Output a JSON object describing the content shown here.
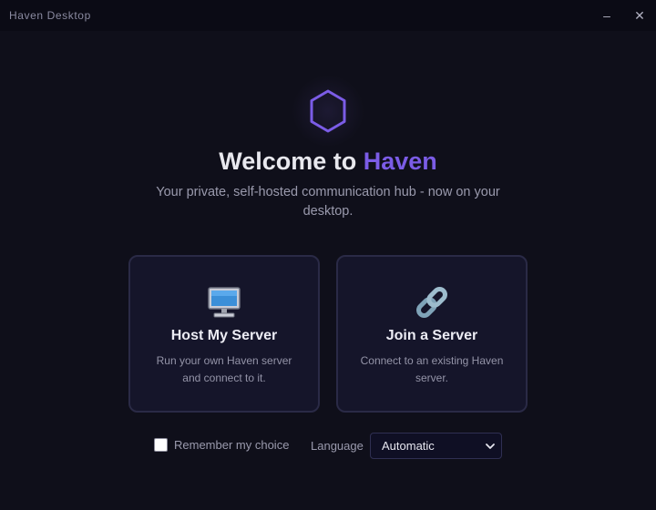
{
  "window": {
    "title": "Haven Desktop",
    "minimize_label": "–",
    "close_label": "✕"
  },
  "welcome": {
    "heading_prefix": "Welcome to ",
    "heading_brand": "Haven",
    "subtitle": "Your private, self-hosted communication hub - now on your desktop."
  },
  "options": {
    "host": {
      "icon": "desktop-computer-icon",
      "title": "Host My Server",
      "description": "Run your own Haven server and connect to it."
    },
    "join": {
      "icon": "link-icon",
      "title": "Join a Server",
      "description": "Connect to an existing Haven server."
    }
  },
  "footer": {
    "remember_label": "Remember my choice",
    "remember_checked": false,
    "language_label": "Language",
    "language_value": "Automatic"
  },
  "colors": {
    "background": "#0f0f1a",
    "accent": "#7b5ce6",
    "card_background": "#15152a",
    "card_border": "#2a2a46"
  }
}
